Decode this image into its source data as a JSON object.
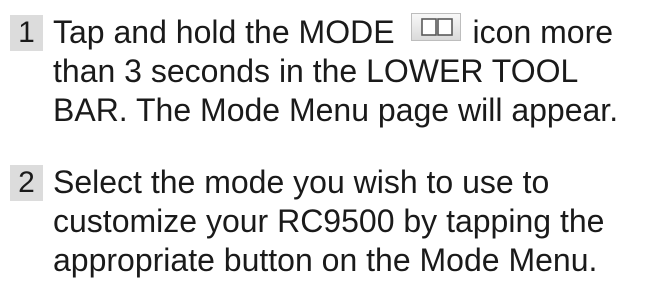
{
  "steps": [
    {
      "number": "1",
      "lines": [
        {
          "before_icon": "Tap and hold the MODE",
          "after_icon": "icon more"
        },
        "than 3 seconds in the LOWER TOOL",
        "BAR. The Mode Menu page will appear."
      ],
      "icon": "mode-book-icon"
    },
    {
      "number": "2",
      "lines": [
        "Select the mode you wish to use to",
        "customize your RC9500 by tapping the",
        "appropriate button on the Mode Menu."
      ]
    }
  ]
}
